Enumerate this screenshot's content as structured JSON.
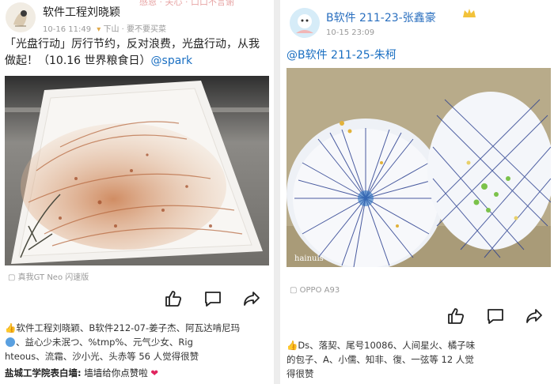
{
  "left_post": {
    "author": "软件工程刘晓颖",
    "time": "10-16 11:49",
    "location": "下山 · 要不要买菜",
    "banner": "感恩 · 关心 · 口口不言谢",
    "text_line1": "「光盘行动」厉行节约，反对浪费，光盘行动，从我",
    "text_line2_plain": "做起！（10.16 世界粮食日）",
    "text_mention": "@spark",
    "photo_device": "真我GT Neo 闪速版",
    "likes_line1": "软件工程刘晓颖、B软件212-07-姜子杰、阿瓦达啃尼玛",
    "likes_line2": "、益心少未泯つ、%tmp%、元气少女、Rig",
    "likes_line3": "hteous、流霜、沙小光、头赤等 56 人觉得很赞",
    "comment_author": "盐城工学院表白墙:",
    "comment_text": "墙墙给你点赞啦"
  },
  "right_post": {
    "author": "B软件 211-23-张鑫豪",
    "time": "10-15 23:09",
    "text_mention": "@B软件 211-25-朱柯",
    "photo_watermark": "hainuis",
    "photo_device": "OPPO A93",
    "likes_line1": "Ds、落契、尾号10086、人间星火、橘子味",
    "likes_line2": "的包子、A、小儒、知非、復、一弦等 12 人觉",
    "likes_line3": "得很赞"
  },
  "icons": [
    "heart-icon",
    "thumbs-up-icon",
    "comment-icon",
    "share-icon",
    "crown-icon",
    "location-icon",
    "camera-icon"
  ],
  "colors": {
    "mention": "#1a6fc2",
    "meta": "#999999",
    "heart": "#e0245e",
    "divider": "#ededed"
  }
}
